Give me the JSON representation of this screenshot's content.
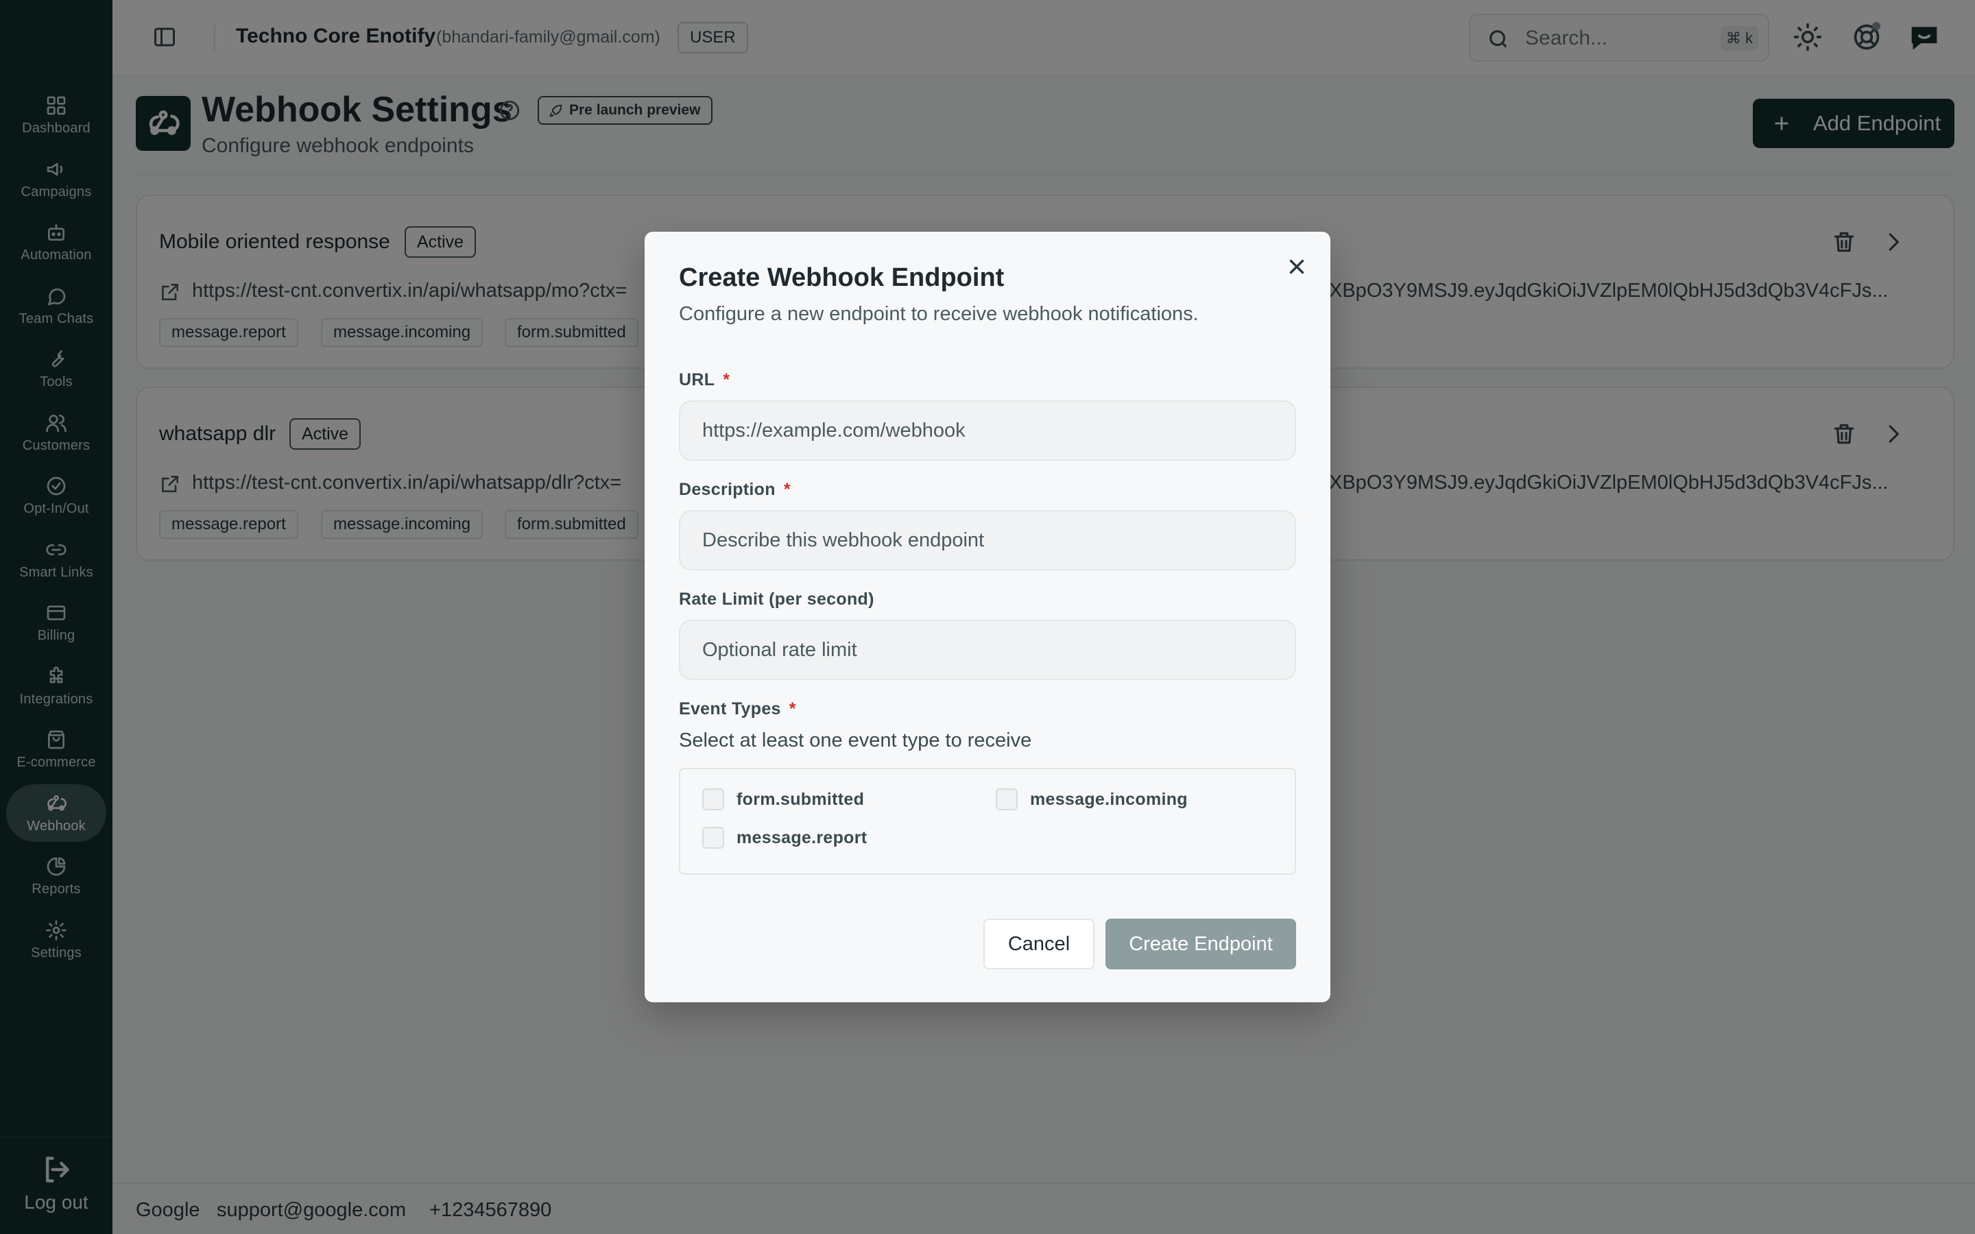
{
  "header": {
    "org_name": "Techno Core Enotify",
    "org_email": "(bhandari-family@gmail.com)",
    "role": "USER",
    "search_placeholder": "Search...",
    "search_shortcut": "⌘ k"
  },
  "sidebar": {
    "items": [
      {
        "label": "Dashboard",
        "icon": "grid-icon"
      },
      {
        "label": "Campaigns",
        "icon": "megaphone-icon"
      },
      {
        "label": "Automation",
        "icon": "bot-icon"
      },
      {
        "label": "Team Chats",
        "icon": "chat-icon"
      },
      {
        "label": "Tools",
        "icon": "wrench-icon"
      },
      {
        "label": "Customers",
        "icon": "users-icon"
      },
      {
        "label": "Opt-In/Out",
        "icon": "check-circle-icon"
      },
      {
        "label": "Smart Links",
        "icon": "link-icon"
      },
      {
        "label": "Billing",
        "icon": "card-icon"
      },
      {
        "label": "Integrations",
        "icon": "puzzle-icon"
      },
      {
        "label": "E-commerce",
        "icon": "bag-icon"
      },
      {
        "label": "Webhook",
        "icon": "webhook-icon",
        "active": true
      },
      {
        "label": "Reports",
        "icon": "pie-icon"
      },
      {
        "label": "Settings",
        "icon": "gear-icon"
      }
    ],
    "logout_label": "Log out"
  },
  "page": {
    "title": "Webhook Settings",
    "badge": "Pre launch preview",
    "subtitle": "Configure webhook endpoints",
    "add_button": "Add Endpoint"
  },
  "endpoints": [
    {
      "name": "Mobile oriented response",
      "status": "Active",
      "url_start": "https://test-cnt.convertix.in/api/whatsapp/mo?ctx=",
      "url_end": "XBpO3Y9MSJ9.eyJqdGkiOiJVZlpEM0lQbHJ5d3dQb3V4cFJs...",
      "events": [
        "message.report",
        "message.incoming",
        "form.submitted"
      ]
    },
    {
      "name": "whatsapp dlr",
      "status": "Active",
      "url_start": "https://test-cnt.convertix.in/api/whatsapp/dlr?ctx=",
      "url_end": "XBpO3Y9MSJ9.eyJqdGkiOiJVZlpEM0lQbHJ5d3dQb3V4cFJs...",
      "events": [
        "message.report",
        "message.incoming",
        "form.submitted"
      ]
    }
  ],
  "footer": {
    "company": "Google",
    "email": "support@google.com",
    "phone": "+1234567890"
  },
  "modal": {
    "title": "Create Webhook Endpoint",
    "description": "Configure a new endpoint to receive webhook notifications.",
    "url_label": "URL",
    "url_placeholder": "https://example.com/webhook",
    "description_label": "Description",
    "description_placeholder": "Describe this webhook endpoint",
    "rate_label": "Rate Limit (per second)",
    "rate_placeholder": "Optional rate limit",
    "events_label": "Event Types",
    "events_help": "Select at least one event type to receive",
    "event_options": [
      "form.submitted",
      "message.incoming",
      "message.report"
    ],
    "required_mark": "*",
    "cancel_label": "Cancel",
    "create_label": "Create Endpoint"
  },
  "colors": {
    "sidebar": "#13302f",
    "primary": "#13302f",
    "disabled_button": "#8d9da0",
    "required": "#d0312d"
  }
}
